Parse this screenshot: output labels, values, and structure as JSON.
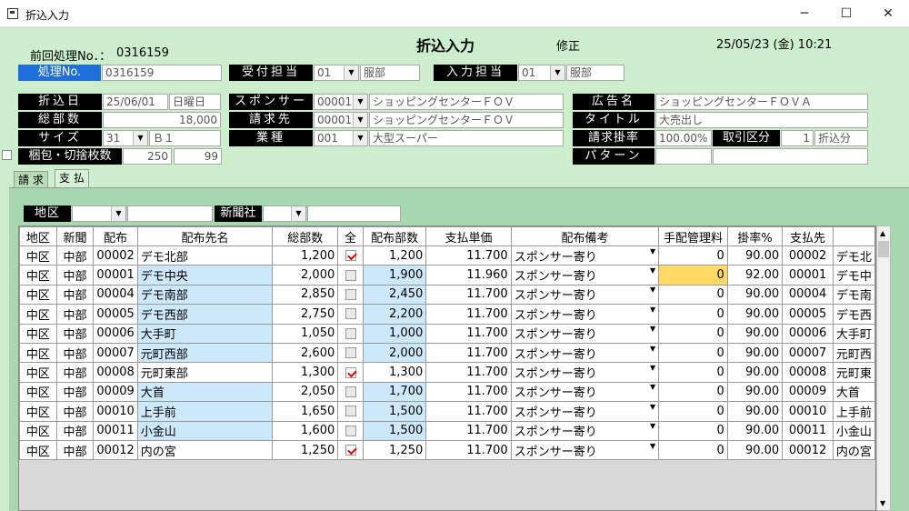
{
  "window": {
    "title": "折込入力",
    "minimize": "─",
    "maximize": "☐",
    "close": "✕"
  },
  "header": {
    "prev_label": "前回処理No．：",
    "prev_value": "0316159",
    "title": "折込入力",
    "mode": "修正",
    "datetime": "25/05/23 (金) 10:21"
  },
  "form": {
    "shori_label": "処理No.",
    "shori_value": "0316159",
    "uketsuke_label": "受付担当",
    "uketsuke_code": "01",
    "uketsuke_name": "服部",
    "nyuryoku_label": "入力担当",
    "nyuryoku_code": "01",
    "nyuryoku_name": "服部",
    "orikomi_label": "折込日",
    "orikomi_date": "25/06/01",
    "orikomi_day": "日曜日",
    "sponsor_label": "スポンサー",
    "sponsor_code": "00001",
    "sponsor_name": "ショッピングセンターＦＯＶ",
    "kokoku_label": "広告名",
    "kokoku_value": "ショッピングセンターＦＯＶＡ",
    "sobusu_label": "総部数",
    "sobusu_value": "18,000",
    "seikyusaki_label": "請求先",
    "seikyusaki_code": "00001",
    "seikyusaki_name": "ショッピングセンターＦＯＶ",
    "title_label": "タイトル",
    "title_value": "大売出し",
    "size_label": "サイズ",
    "size_code": "31",
    "size_name": "Ｂ１",
    "gyoshu_label": "業種",
    "gyoshu_code": "001",
    "gyoshu_name": "大型スーパー",
    "kakeritsu_label": "請求掛率",
    "kakeritsu_value": "100.00%",
    "torihiki_label": "取引区分",
    "torihiki_code": "1",
    "torihiki_name": "折込分",
    "konpo_label": "梱包・切捨枚数",
    "konpo_value1": "250",
    "konpo_value2": "99",
    "pattern_label": "パターン",
    "pattern_value1": "",
    "pattern_value2": ""
  },
  "tabs": {
    "seikyu": "請 求",
    "shiharai": "支 払"
  },
  "filters": {
    "chiku_label": "地区",
    "chiku_value": "",
    "chiku_text": "",
    "shinbun_label": "新聞社",
    "shinbun_value": "",
    "shinbun_text": ""
  },
  "table": {
    "headers": [
      "地区",
      "新聞",
      "配布",
      "配布先名",
      "総部数",
      "全",
      "配布部数",
      "支払単価",
      "配布備考",
      "手配管理料",
      "掛率%",
      "支払先",
      ""
    ],
    "rows": [
      {
        "chiku": "中区",
        "shinbun": "中部",
        "haifu": "00002",
        "name": "デモ北部",
        "sobusu": "1,200",
        "all": true,
        "haifusu": "1,200",
        "tanka": "11.700",
        "biko": "スポンサー寄り",
        "fee": "0",
        "rate": "90.00",
        "payee_code": "00002",
        "payee_name": "デモ北",
        "hl": false,
        "sel": false
      },
      {
        "chiku": "中区",
        "shinbun": "中部",
        "haifu": "00001",
        "name": "デモ中央",
        "sobusu": "2,000",
        "all": false,
        "haifusu": "1,900",
        "tanka": "11.960",
        "biko": "スポンサー寄り",
        "fee": "0",
        "rate": "92.00",
        "payee_code": "00001",
        "payee_name": "デモ中",
        "hl": true,
        "sel": true
      },
      {
        "chiku": "中区",
        "shinbun": "中部",
        "haifu": "00004",
        "name": "デモ南部",
        "sobusu": "2,850",
        "all": false,
        "haifusu": "2,450",
        "tanka": "11.700",
        "biko": "スポンサー寄り",
        "fee": "0",
        "rate": "90.00",
        "payee_code": "00004",
        "payee_name": "デモ南",
        "hl": true,
        "sel": false
      },
      {
        "chiku": "中区",
        "shinbun": "中部",
        "haifu": "00005",
        "name": "デモ西部",
        "sobusu": "2,750",
        "all": false,
        "haifusu": "2,200",
        "tanka": "11.700",
        "biko": "スポンサー寄り",
        "fee": "0",
        "rate": "90.00",
        "payee_code": "00005",
        "payee_name": "デモ西",
        "hl": true,
        "sel": false
      },
      {
        "chiku": "中区",
        "shinbun": "中部",
        "haifu": "00006",
        "name": "大手町",
        "sobusu": "1,050",
        "all": false,
        "haifusu": "1,000",
        "tanka": "11.700",
        "biko": "スポンサー寄り",
        "fee": "0",
        "rate": "90.00",
        "payee_code": "00006",
        "payee_name": "大手町",
        "hl": true,
        "sel": false
      },
      {
        "chiku": "中区",
        "shinbun": "中部",
        "haifu": "00007",
        "name": "元町西部",
        "sobusu": "2,600",
        "all": false,
        "haifusu": "2,000",
        "tanka": "11.700",
        "biko": "スポンサー寄り",
        "fee": "0",
        "rate": "90.00",
        "payee_code": "00007",
        "payee_name": "元町西",
        "hl": true,
        "sel": false
      },
      {
        "chiku": "中区",
        "shinbun": "中部",
        "haifu": "00008",
        "name": "元町東部",
        "sobusu": "1,300",
        "all": true,
        "haifusu": "1,300",
        "tanka": "11.700",
        "biko": "スポンサー寄り",
        "fee": "0",
        "rate": "90.00",
        "payee_code": "00008",
        "payee_name": "元町東",
        "hl": false,
        "sel": false
      },
      {
        "chiku": "中区",
        "shinbun": "中部",
        "haifu": "00009",
        "name": "大首",
        "sobusu": "2,050",
        "all": false,
        "haifusu": "1,700",
        "tanka": "11.700",
        "biko": "スポンサー寄り",
        "fee": "0",
        "rate": "90.00",
        "payee_code": "00009",
        "payee_name": "大首",
        "hl": true,
        "sel": false
      },
      {
        "chiku": "中区",
        "shinbun": "中部",
        "haifu": "00010",
        "name": "上手前",
        "sobusu": "1,650",
        "all": false,
        "haifusu": "1,500",
        "tanka": "11.700",
        "biko": "スポンサー寄り",
        "fee": "0",
        "rate": "90.00",
        "payee_code": "00010",
        "payee_name": "上手前",
        "hl": true,
        "sel": false
      },
      {
        "chiku": "中区",
        "shinbun": "中部",
        "haifu": "00011",
        "name": "小金山",
        "sobusu": "1,600",
        "all": false,
        "haifusu": "1,500",
        "tanka": "11.700",
        "biko": "スポンサー寄り",
        "fee": "0",
        "rate": "90.00",
        "payee_code": "00011",
        "payee_name": "小金山",
        "hl": true,
        "sel": false
      },
      {
        "chiku": "中区",
        "shinbun": "中部",
        "haifu": "00012",
        "name": "内の宮",
        "sobusu": "1,250",
        "all": true,
        "haifusu": "1,250",
        "tanka": "11.700",
        "biko": "スポンサー寄り",
        "fee": "0",
        "rate": "90.00",
        "payee_code": "00012",
        "payee_name": "内の宮",
        "hl": false,
        "sel": false
      }
    ]
  },
  "icons": {
    "dropdown": "▼",
    "scroll_up": "▲",
    "scroll_down": "▼"
  },
  "colors": {
    "bg": "#cceecc",
    "panel": "#a8d8b0",
    "highlight": "#cce8fa",
    "selected": "#ffd966",
    "label_blue": "#1e6fd9"
  }
}
